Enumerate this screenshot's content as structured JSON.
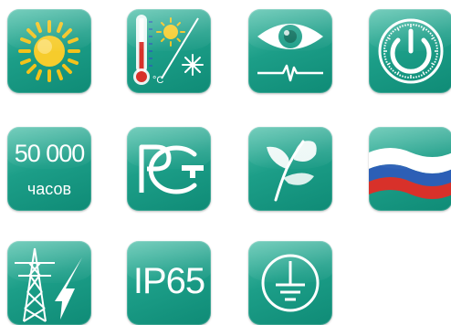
{
  "colors": {
    "tile": "#1c9e88",
    "tile_light": "#4fc0aa",
    "tile_dark": "#0f8b76",
    "sun": "#f4c21a",
    "flag_white": "#ffffff",
    "flag_blue": "#2c5fb6",
    "flag_red": "#d8312a"
  },
  "icons": [
    "sun-icon",
    "thermometer-weather-icon",
    "eye-pulse-icon",
    "power-timer-icon",
    "lifetime-hours-icon",
    "pct-certification-icon",
    "leaf-eco-icon",
    "russian-flag-icon",
    "power-line-lightning-icon",
    "ip-rating-icon",
    "ground-symbol-icon"
  ],
  "thermometer_unit": "°C",
  "lifetime": {
    "value": "50 000",
    "unit": "часов"
  },
  "certification": {
    "letters": "РСТ"
  },
  "ip_rating": "IP65"
}
